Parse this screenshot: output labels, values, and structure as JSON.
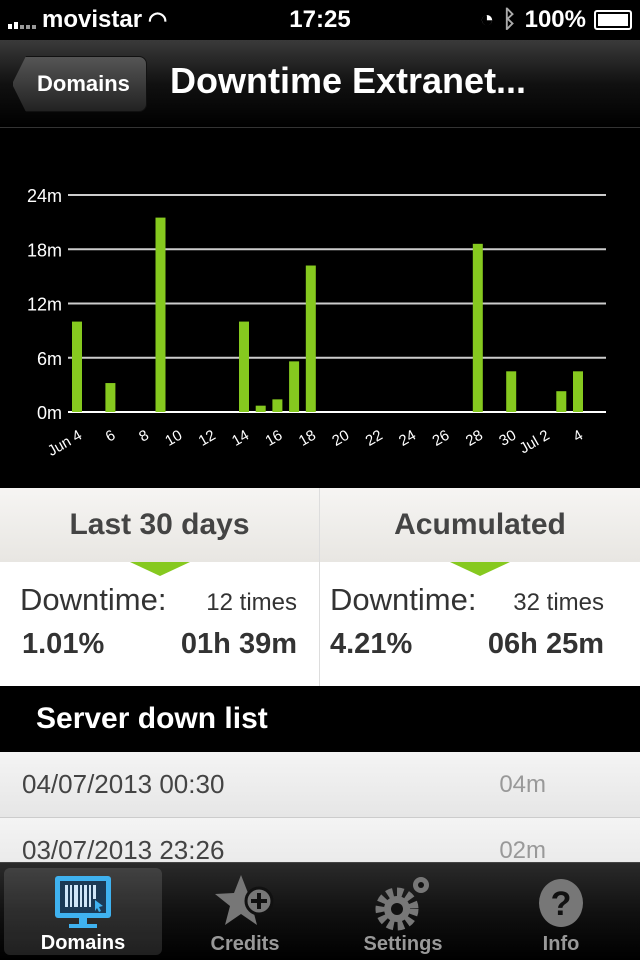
{
  "status_bar": {
    "carrier": "movistar",
    "time": "17:25",
    "battery": "100%"
  },
  "nav": {
    "back_label": "Domains",
    "title": "Downtime Extranet..."
  },
  "chart_data": {
    "type": "bar",
    "title": "",
    "xlabel": "",
    "ylabel": "",
    "ylim": [
      0,
      24
    ],
    "yticks": [
      "0m",
      "6m",
      "12m",
      "18m",
      "24m"
    ],
    "ytick_values": [
      0,
      6,
      12,
      18,
      24
    ],
    "xtick_labels": [
      "Jun 4",
      "6",
      "8",
      "10",
      "12",
      "14",
      "16",
      "18",
      "20",
      "22",
      "24",
      "26",
      "28",
      "30",
      "Jul 2",
      "4"
    ],
    "categories": [
      "Jun 4",
      "Jun 5",
      "Jun 6",
      "Jun 7",
      "Jun 8",
      "Jun 9",
      "Jun 10",
      "Jun 11",
      "Jun 12",
      "Jun 13",
      "Jun 14",
      "Jun 15",
      "Jun 16",
      "Jun 17",
      "Jun 18",
      "Jun 19",
      "Jun 20",
      "Jun 21",
      "Jun 22",
      "Jun 23",
      "Jun 24",
      "Jun 25",
      "Jun 26",
      "Jun 27",
      "Jun 28",
      "Jun 29",
      "Jun 30",
      "Jul 1",
      "Jul 2",
      "Jul 3",
      "Jul 4"
    ],
    "values": [
      10,
      0,
      3.2,
      0,
      0,
      21.5,
      0,
      0,
      0,
      0,
      10,
      0.7,
      1.4,
      5.6,
      16.2,
      0,
      0,
      0,
      0,
      0,
      0,
      0,
      0,
      0,
      18.6,
      0,
      4.5,
      0,
      0,
      2.3,
      4.5
    ],
    "unit": "minutes",
    "grid": true,
    "bar_color": "#86c91f"
  },
  "stats": {
    "last30": {
      "title": "Last 30 days",
      "label": "Downtime:",
      "times": "12 times",
      "percent": "1.01%",
      "duration": "01h 39m"
    },
    "accumulated": {
      "title": "Acumulated",
      "label": "Downtime:",
      "times": "32 times",
      "percent": "4.21%",
      "duration": "06h 25m"
    }
  },
  "server_down": {
    "title": "Server down list",
    "items": [
      {
        "date": "04/07/2013 00:30",
        "duration": "04m"
      },
      {
        "date": "03/07/2013 23:26",
        "duration": "02m"
      }
    ]
  },
  "tabs": [
    {
      "label": "Domains",
      "icon": "monitor-barcode-icon",
      "active": true
    },
    {
      "label": "Credits",
      "icon": "star-plus-icon"
    },
    {
      "label": "Settings",
      "icon": "gears-icon"
    },
    {
      "label": "Info",
      "icon": "question-icon"
    }
  ]
}
